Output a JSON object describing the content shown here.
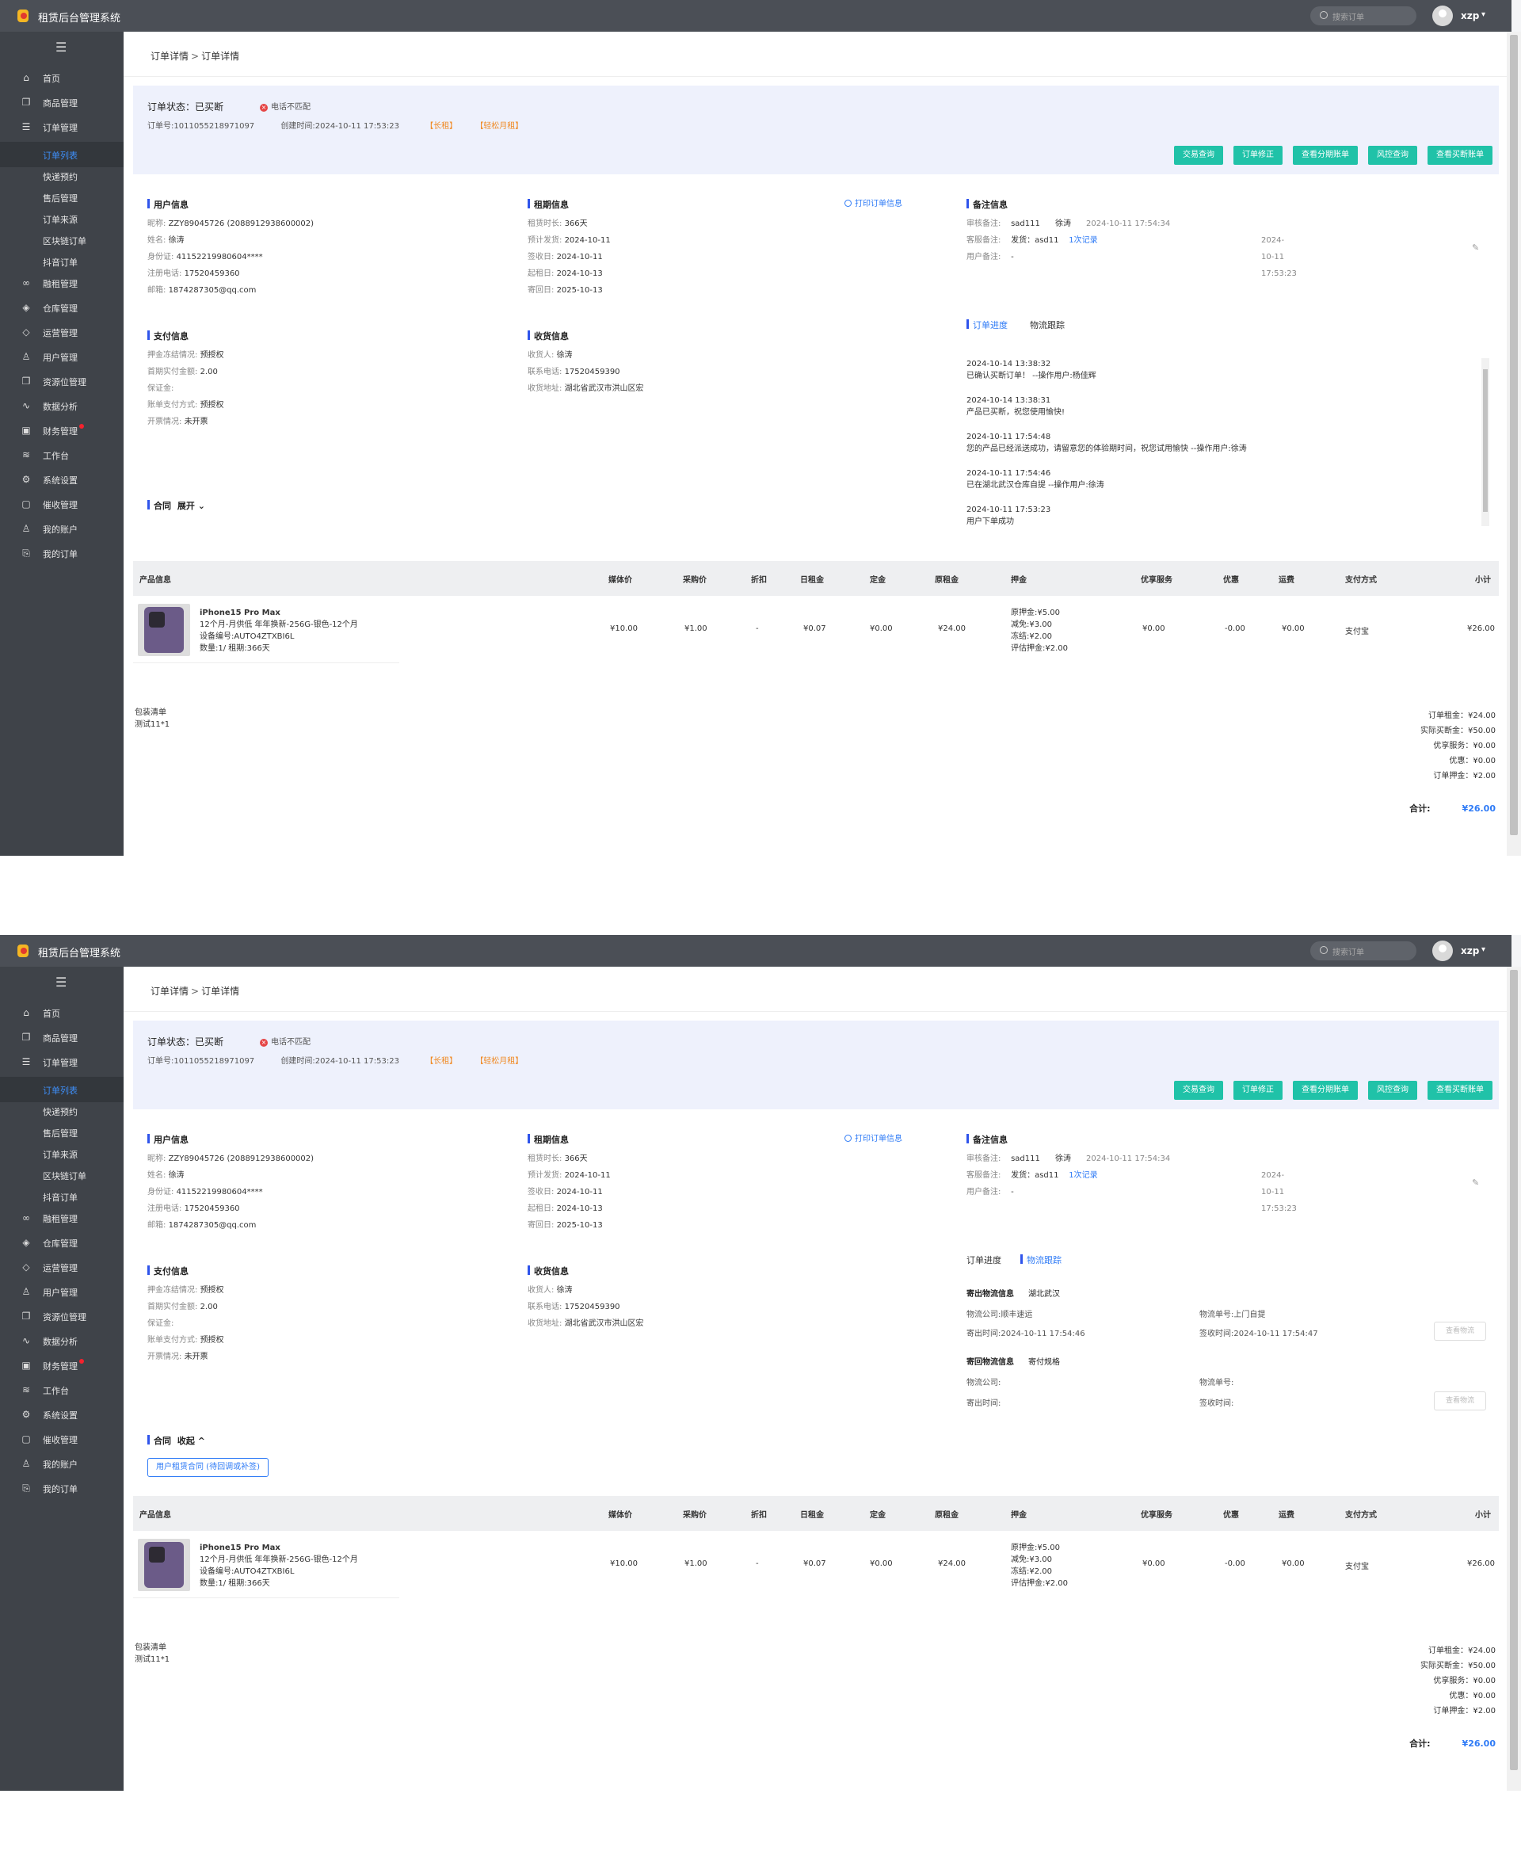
{
  "app": {
    "title": "租赁后台管理系统"
  },
  "header": {
    "search_placeholder": "搜索订单",
    "username": "xzp"
  },
  "sidebar": {
    "items": [
      {
        "label": "首页",
        "icon": "home-icon"
      },
      {
        "label": "商品管理",
        "icon": "copy-icon"
      },
      {
        "label": "订单管理",
        "icon": "list-icon"
      },
      {
        "label": "订单列表",
        "sub": true,
        "active": true
      },
      {
        "label": "快递预约",
        "sub": true
      },
      {
        "label": "售后管理",
        "sub": true
      },
      {
        "label": "订单来源",
        "sub": true
      },
      {
        "label": "区块链订单",
        "sub": true
      },
      {
        "label": "抖音订单",
        "sub": true
      },
      {
        "label": "融租管理",
        "icon": "infinity-icon"
      },
      {
        "label": "仓库管理",
        "icon": "layers-icon"
      },
      {
        "label": "运营管理",
        "icon": "tag-icon"
      },
      {
        "label": "用户管理",
        "icon": "user-icon"
      },
      {
        "label": "资源位管理",
        "icon": "copy-icon"
      },
      {
        "label": "数据分析",
        "icon": "chart-icon"
      },
      {
        "label": "财务管理",
        "icon": "wallet-icon",
        "dot": true
      },
      {
        "label": "工作台",
        "icon": "stack-icon"
      },
      {
        "label": "系统设置",
        "icon": "gear-icon"
      },
      {
        "label": "催收管理",
        "icon": "box-icon"
      },
      {
        "label": "我的账户",
        "icon": "user-icon"
      },
      {
        "label": "我的订单",
        "icon": "clip-icon"
      }
    ]
  },
  "breadcrumb": {
    "parent": "订单详情",
    "separator": ">",
    "current": "订单详情"
  },
  "status": {
    "label": "订单状态：已买断",
    "warning": "电话不匹配",
    "order_no": "订单号:1011055218971097",
    "created": "创建时间:2024-10-11 17:53:23",
    "tags": [
      "【长租】",
      "【轻松月租】"
    ],
    "buttons": [
      "交易查询",
      "订单修正",
      "查看分期账单",
      "风控查询",
      "查看买断账单"
    ]
  },
  "user_info": {
    "title": "用户信息",
    "rows": [
      {
        "k": "昵称:",
        "v": "ZZY89045726 (2088912938600002)"
      },
      {
        "k": "姓名:",
        "v": "徐涛"
      },
      {
        "k": "身份证:",
        "v": "41152219980604****"
      },
      {
        "k": "注册电话:",
        "v": "17520459360"
      },
      {
        "k": "邮箱:",
        "v": "1874287305@qq.com"
      }
    ]
  },
  "lease_info": {
    "title": "租期信息",
    "print": "打印订单信息",
    "rows": [
      {
        "k": "租赁时长:",
        "v": "366天"
      },
      {
        "k": "预计发货:",
        "v": "2024-10-11"
      },
      {
        "k": "签收日:",
        "v": "2024-10-11"
      },
      {
        "k": "起租日:",
        "v": "2024-10-13"
      },
      {
        "k": "寄回日:",
        "v": "2025-10-13"
      }
    ]
  },
  "pay_info": {
    "title": "支付信息",
    "rows": [
      {
        "k": "押金冻结情况:",
        "v": "预授权"
      },
      {
        "k": "首期实付金额:",
        "v": "2.00"
      },
      {
        "k": "保证金:",
        "v": ""
      },
      {
        "k": "账单支付方式:",
        "v": "预授权"
      },
      {
        "k": "开票情况:",
        "v": "未开票"
      }
    ]
  },
  "receive_info": {
    "title": "收货信息",
    "rows": [
      {
        "k": "收货人:",
        "v": "徐涛"
      },
      {
        "k": "联系电话:",
        "v": "17520459390"
      },
      {
        "k": "收货地址:",
        "v": "湖北省武汉市洪山区宏"
      }
    ]
  },
  "contract": {
    "title": "合同",
    "expand": "展开",
    "collapse": "收起",
    "chev_down": "⌄",
    "chev_up": "^",
    "button": "用户租赁合同 (待回调或补签)"
  },
  "remarks": {
    "title": "备注信息",
    "audit_label": "审核备注:",
    "audit_who": "sad111",
    "audit_name": "徐涛",
    "audit_time": "2024-10-11 17:54:34",
    "service_label": "客服备注:",
    "service_text": "发货：asd11",
    "service_link": "1次记录",
    "service_time": "2024-10-11 17:53:23",
    "user_label": "用户备注:",
    "user_value": "-"
  },
  "timeline": {
    "tab_progress": "订单进度",
    "tab_logistics": "物流跟踪",
    "entries": [
      {
        "time": "2024-10-14 13:38:32",
        "text": "已确认买断订单！ --操作用户:杨佳辉"
      },
      {
        "time": "2024-10-14 13:38:31",
        "text": "产品已买断，祝您使用愉快!"
      },
      {
        "time": "2024-10-11 17:54:48",
        "text": "您的产品已经派送成功，请留意您的体验期时间，祝您试用愉快 --操作用户:徐涛"
      },
      {
        "time": "2024-10-11 17:54:46",
        "text": "已在湖北武汉仓库自提 --操作用户:徐涛"
      },
      {
        "time": "2024-10-11 17:53:23",
        "text": "用户下单成功"
      }
    ]
  },
  "logistics": {
    "send_title": "寄出物流信息",
    "send_sub": "湖北武汉",
    "company": "物流公司:顺丰速运",
    "waybill": "物流单号:上门自提",
    "send_time": "寄出时间:2024-10-11 17:54:46",
    "sign_time": "签收时间:2024-10-11 17:54:47",
    "view": "查看物流",
    "return_title": "寄回物流信息",
    "return_sub": "寄付规格",
    "r_company": "物流公司:",
    "r_waybill": "物流单号:",
    "r_send": "寄出时间:",
    "r_sign": "签收时间:"
  },
  "product_table": {
    "headers": [
      "产品信息",
      "媒体价",
      "采购价",
      "折扣",
      "日租金",
      "定金",
      "原租金",
      "押金",
      "优享服务",
      "优惠",
      "运费",
      "支付方式",
      "小计"
    ],
    "row": {
      "name": "iPhone15 Pro Max",
      "spec": "12个月-月供低 年年换新-256G-银色-12个月",
      "device": "设备编号:AUTO4ZTXBI6L",
      "qty": "数量:1/ 租期:366天",
      "media_price": "¥10.00",
      "purchase_price": "¥1.00",
      "discount": "-",
      "daily_rent": "¥0.07",
      "deposit_fee": "¥0.00",
      "orig_rent": "¥24.00",
      "deposit_lines": [
        "原押金:¥5.00",
        "减免:¥3.00",
        "冻结:¥2.00",
        "评估押金:¥2.00"
      ],
      "service": "¥0.00",
      "coupon": "-0.00",
      "shipping": "¥0.00",
      "pay_method": "支付宝",
      "subtotal": "¥26.00"
    },
    "packing_title": "包装清单",
    "packing_item": "测试11*1",
    "summary": [
      "订单租金：¥24.00",
      "实际买断金：¥50.00",
      "优享服务：¥0.00",
      "优惠：¥0.00",
      "订单押金：¥2.00"
    ],
    "total_label": "合计:",
    "total_value": "¥26.00"
  }
}
